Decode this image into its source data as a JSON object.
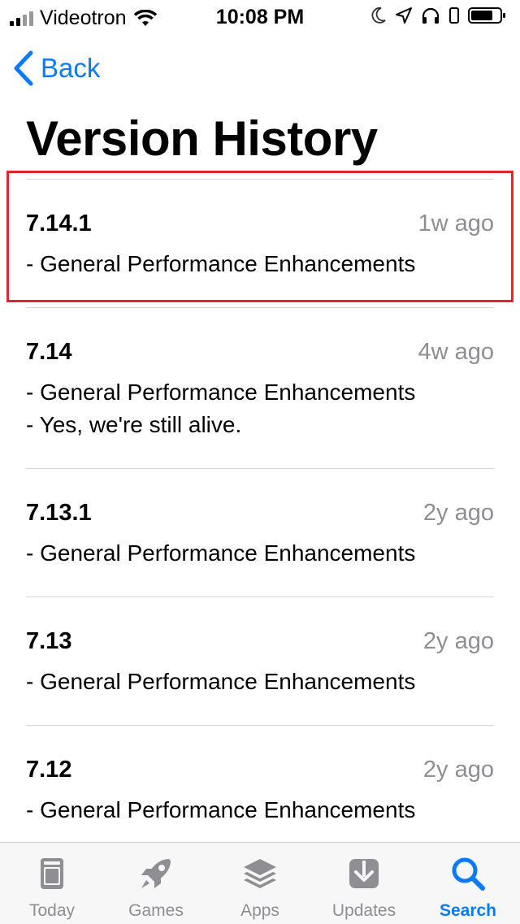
{
  "status_bar": {
    "carrier": "Videotron",
    "time": "10:08 PM"
  },
  "nav": {
    "back_label": "Back"
  },
  "page": {
    "title": "Version History"
  },
  "versions": [
    {
      "version": "7.14.1",
      "ago": "1w ago",
      "notes": [
        "- General Performance Enhancements"
      ],
      "highlighted": true
    },
    {
      "version": "7.14",
      "ago": "4w ago",
      "notes": [
        "- General Performance Enhancements",
        "- Yes, we're still alive."
      ]
    },
    {
      "version": "7.13.1",
      "ago": "2y ago",
      "notes": [
        "- General Performance Enhancements"
      ]
    },
    {
      "version": "7.13",
      "ago": "2y ago",
      "notes": [
        "- General Performance Enhancements"
      ]
    },
    {
      "version": "7.12",
      "ago": "2y ago",
      "notes": [
        "- General Performance Enhancements"
      ]
    }
  ],
  "tab_bar": {
    "tabs": [
      {
        "label": "Today",
        "icon": "today-icon"
      },
      {
        "label": "Games",
        "icon": "rocket-icon"
      },
      {
        "label": "Apps",
        "icon": "layers-icon"
      },
      {
        "label": "Updates",
        "icon": "download-icon"
      },
      {
        "label": "Search",
        "icon": "search-icon",
        "active": true
      }
    ]
  },
  "colors": {
    "accent": "#0a7bff",
    "secondary_text": "#8e8e93",
    "highlight_border": "#e0262c"
  }
}
